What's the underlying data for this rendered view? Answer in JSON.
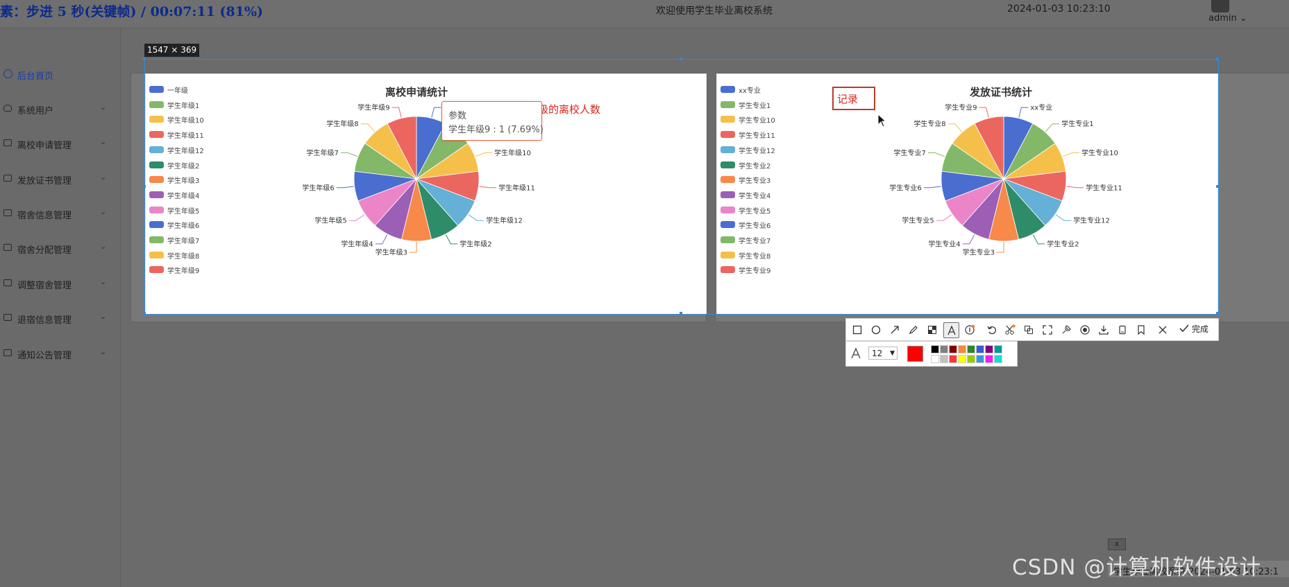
{
  "recorder": {
    "overlay": "素：步进 5 秒(关键帧) / 00:07:11 (81%)"
  },
  "header": {
    "welcome": "欢迎使用学生毕业离校系统",
    "datetime": "2024-01-03 10:23:10",
    "user": "admin",
    "user_caret": "⌄"
  },
  "sidebar": {
    "caret": "⌄",
    "items": [
      {
        "label": "后台首页",
        "icon": "dashboard-icon",
        "active": true
      },
      {
        "label": "系统用户",
        "icon": "user-icon"
      },
      {
        "label": "离校申请管理",
        "icon": "folder-icon"
      },
      {
        "label": "发放证书管理",
        "icon": "folder-icon"
      },
      {
        "label": "宿舍信息管理",
        "icon": "folder-icon"
      },
      {
        "label": "宿舍分配管理",
        "icon": "folder-icon"
      },
      {
        "label": "调整宿舍管理",
        "icon": "folder-icon"
      },
      {
        "label": "退宿信息管理",
        "icon": "folder-icon"
      },
      {
        "label": "通知公告管理",
        "icon": "folder-icon"
      }
    ]
  },
  "capture": {
    "size_label": "1547 × 369"
  },
  "charts": {
    "colors": [
      "#4a6dd0",
      "#83b868",
      "#f5c04a",
      "#ec6660",
      "#64b0d6",
      "#2f8c68",
      "#f7894a",
      "#9b5fb5",
      "#ec85c8"
    ],
    "left": {
      "annotation": "记录什么年级的离校人数",
      "tooltip": {
        "title": "参数",
        "value": "学生年级9 : 1 (7.69%)"
      }
    },
    "right": {
      "annotation_box": "记录"
    }
  },
  "chart_data": [
    {
      "type": "pie",
      "title": "离校申请统计",
      "categories": [
        "一年级",
        "学生年级1",
        "学生年级10",
        "学生年级11",
        "学生年级12",
        "学生年级2",
        "学生年级3",
        "学生年级4",
        "学生年级5",
        "学生年级6",
        "学生年级7",
        "学生年级8",
        "学生年级9"
      ],
      "values": [
        1,
        1,
        1,
        1,
        1,
        1,
        1,
        1,
        1,
        1,
        1,
        1,
        1
      ],
      "legend": "top-left"
    },
    {
      "type": "pie",
      "title": "发放证书统计",
      "categories": [
        "xx专业",
        "学生专业1",
        "学生专业10",
        "学生专业11",
        "学生专业12",
        "学生专业2",
        "学生专业3",
        "学生专业4",
        "学生专业5",
        "学生专业6",
        "学生专业7",
        "学生专业8",
        "学生专业9"
      ],
      "values": [
        1,
        1,
        1,
        1,
        1,
        1,
        1,
        1,
        1,
        1,
        1,
        1,
        1
      ],
      "legend": "top-left"
    }
  ],
  "toolbar": {
    "done_label": "完成",
    "font_size": "12",
    "current_color": "#ff0000",
    "palette": [
      "#000000",
      "#808080",
      "#800000",
      "#f7883a",
      "#308430",
      "#385ad3",
      "#800080",
      "#009999",
      "#ffffff",
      "#c0c0c0",
      "#fb3838",
      "#ffff00",
      "#99cc00",
      "#3894e4",
      "#f31bf3",
      "#16dcdc"
    ],
    "tools": [
      "rectangle-icon",
      "ellipse-icon",
      "arrow-icon",
      "pen-icon",
      "mosaic-icon",
      "text-icon",
      "number-icon",
      "undo-icon",
      "cut-icon",
      "ocr-icon",
      "fullscreen-icon",
      "pin-icon",
      "record-icon",
      "download-icon",
      "save-icon",
      "bookmark-icon",
      "close-icon",
      "check-icon"
    ]
  },
  "overlay": {
    "close_label": "x",
    "status": "学生毕业离校系统 2024-01-03 10:23:1",
    "watermark": "CSDN @计算机软件设计"
  }
}
